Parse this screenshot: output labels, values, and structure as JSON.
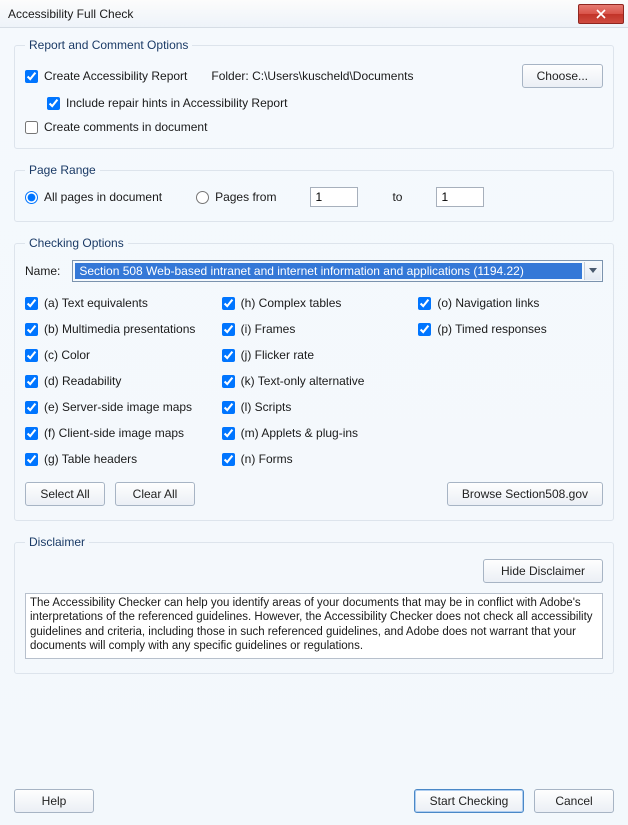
{
  "window": {
    "title": "Accessibility Full Check"
  },
  "report": {
    "legend": "Report and Comment Options",
    "create_report": "Create Accessibility Report",
    "folder_label": "Folder:",
    "folder_path": "C:\\Users\\kuscheld\\Documents",
    "choose": "Choose...",
    "include_hints": "Include repair hints in Accessibility Report",
    "create_comments": "Create comments in document"
  },
  "pagerange": {
    "legend": "Page Range",
    "all_pages": "All pages in document",
    "pages_from": "Pages from",
    "to": "to",
    "from_val": "1",
    "to_val": "1"
  },
  "checking": {
    "legend": "Checking Options",
    "name_label": "Name:",
    "selected": "Section 508 Web-based intranet and internet information and applications (1194.22)",
    "items": {
      "a": "(a) Text equivalents",
      "b": "(b) Multimedia presentations",
      "c": "(c) Color",
      "d": "(d) Readability",
      "e": "(e) Server-side image maps",
      "f": "(f) Client-side image maps",
      "g": "(g) Table headers",
      "h": "(h) Complex tables",
      "i": "(i) Frames",
      "j": "(j) Flicker rate",
      "k": "(k) Text-only alternative",
      "l": "(l) Scripts",
      "m": "(m) Applets & plug-ins",
      "n": "(n) Forms",
      "o": "(o) Navigation links",
      "p": "(p) Timed responses"
    },
    "select_all": "Select All",
    "clear_all": "Clear All",
    "browse": "Browse Section508.gov"
  },
  "disclaimer": {
    "legend": "Disclaimer",
    "hide": "Hide Disclaimer",
    "text": "The Accessibility Checker can help you identify areas of your documents that may be in conflict with Adobe's interpretations of the referenced guidelines. However, the Accessibility Checker does not check all accessibility guidelines and criteria, including those in such referenced guidelines, and Adobe does not warrant that your documents will comply with any specific guidelines or regulations."
  },
  "buttons": {
    "help": "Help",
    "start": "Start Checking",
    "cancel": "Cancel"
  }
}
